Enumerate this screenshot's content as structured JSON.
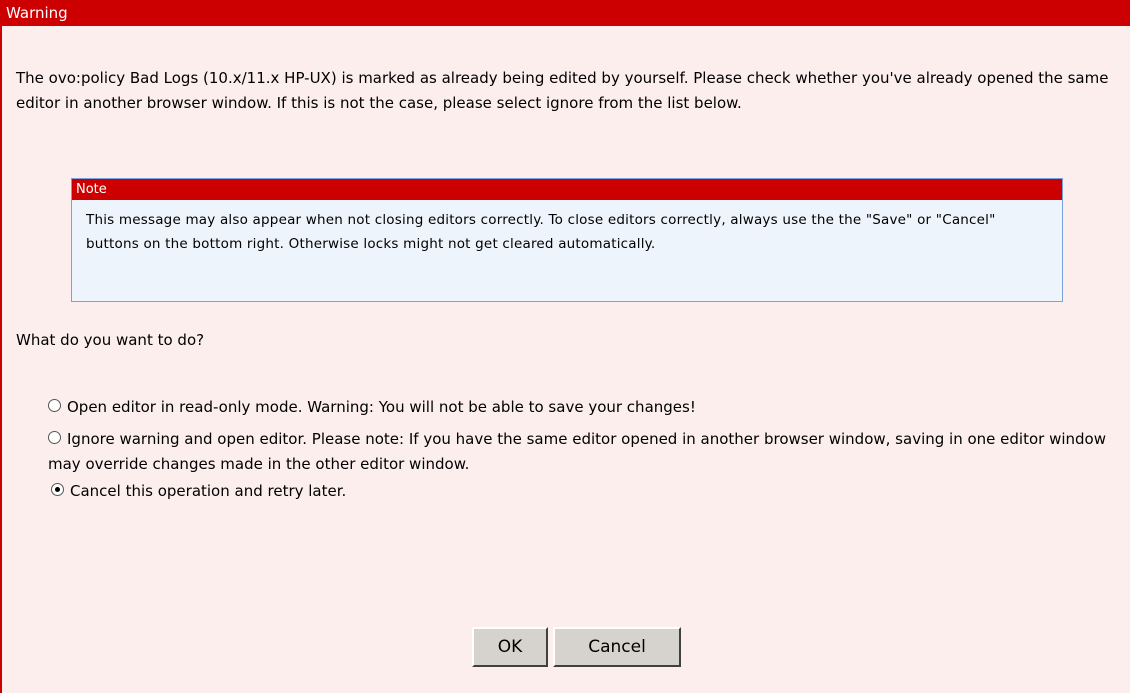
{
  "dialog": {
    "title": "Warning",
    "message": "The ovo:policy Bad Logs (10.x/11.x HP-UX) is marked as already being edited by yourself. Please check whether you've already opened the same editor in another browser window. If this is not the case, please select ignore from the list below.",
    "note": {
      "title": "Note",
      "text": "This message may also appear when not closing editors correctly. To close editors correctly, always use the the \"Save\" or \"Cancel\" buttons on the bottom right. Otherwise locks might not get cleared automatically."
    },
    "question": "What do you want to do?",
    "options": [
      {
        "label": "Open editor in read-only mode. Warning: You will not be able to save your changes!",
        "checked": false
      },
      {
        "label": "Ignore warning and open editor. Please note: If you have the same editor opened in another browser window, saving in one editor window may override changes made in the other editor window.",
        "checked": false
      },
      {
        "label": "Cancel this operation and retry later.",
        "checked": true
      }
    ],
    "buttons": {
      "ok": "OK",
      "cancel": "Cancel"
    }
  },
  "colors": {
    "title_bar": "#cc0000",
    "background": "#fdeeee",
    "note_background": "#eef4fb",
    "note_border": "#7aa2dd"
  }
}
